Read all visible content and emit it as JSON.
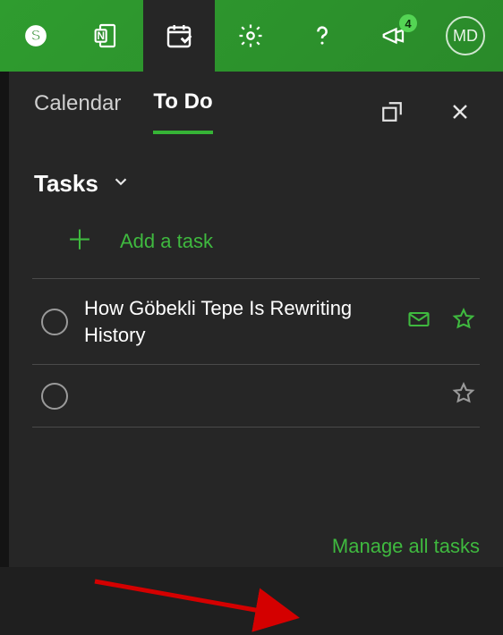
{
  "toolbar": {
    "badge_count": "4",
    "avatar_initials": "MD"
  },
  "panel": {
    "tabs": {
      "calendar": "Calendar",
      "todo": "To Do"
    },
    "section_title": "Tasks",
    "add_task_label": "Add a task",
    "tasks": [
      {
        "title": "How Göbekli Tepe Is Rewriting History",
        "has_mail": true
      },
      {
        "title": "",
        "has_mail": false
      }
    ],
    "manage_link": "Manage all tasks"
  }
}
